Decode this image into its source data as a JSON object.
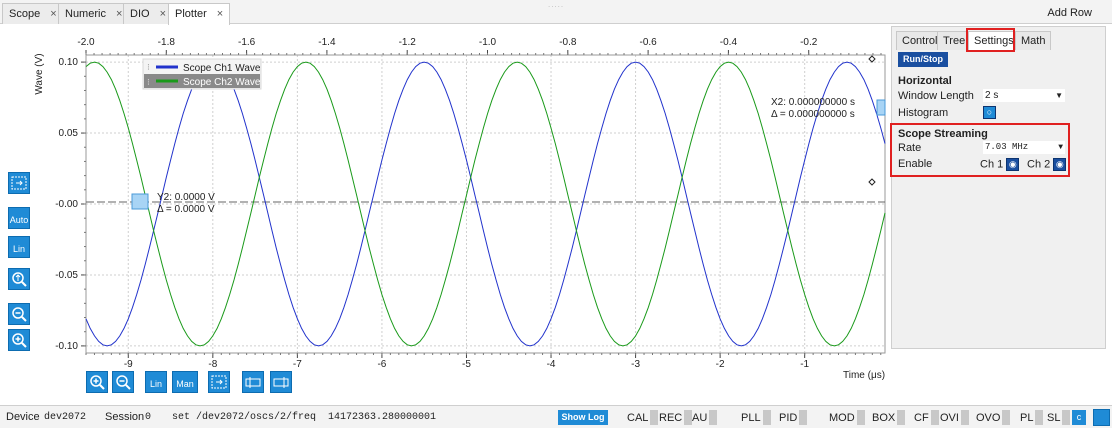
{
  "tabs": [
    {
      "label": "Scope",
      "active": false
    },
    {
      "label": "Numeric",
      "active": false
    },
    {
      "label": "DIO",
      "active": false
    },
    {
      "label": "Plotter",
      "active": true
    }
  ],
  "tab_close": "×",
  "add_row": "Add Row",
  "plot": {
    "y_axis_label": "Wave (V)",
    "x_axis_label": "Time (μs)",
    "top_ticks": [
      "-2.0",
      "-1.8",
      "-1.6",
      "-1.4",
      "-1.2",
      "-1.0",
      "-0.8",
      "-0.6",
      "-0.4",
      "-0.2"
    ],
    "bottom_ticks": [
      "-9",
      "-8",
      "-7",
      "-6",
      "-5",
      "-4",
      "-3",
      "-2",
      "-1"
    ],
    "y_ticks": [
      "0.10",
      "0.05",
      "-0.00",
      "-0.05",
      "-0.10"
    ],
    "legend": [
      {
        "name": "Scope Ch1 Wave",
        "color": "#2233cc"
      },
      {
        "name": "Scope Ch2 Wave",
        "color": "#1a9a1a"
      }
    ],
    "cursor_y": {
      "line1": "Y2: 0.0000 V",
      "line2": "Δ = 0.0000 V"
    },
    "cursor_x": {
      "line1": "X2: 0.000000000 s",
      "line2": "Δ = 0.000000000 s"
    }
  },
  "chart_data": {
    "type": "line",
    "x_range_us": [
      -9.5,
      -0.05
    ],
    "ylim": [
      -0.105,
      0.105
    ],
    "series": [
      {
        "name": "Scope Ch1 Wave",
        "color": "#2233cc",
        "amplitude": 0.1,
        "period_us": 2.5,
        "peak_at_us": -5.5
      },
      {
        "name": "Scope Ch2 Wave",
        "color": "#1a9a1a",
        "amplitude": 0.1,
        "period_us": 2.5,
        "peak_at_us": -6.9
      }
    ],
    "grid": true
  },
  "left_tools": [
    {
      "name": "zoom-fit-icon",
      "label": ""
    },
    {
      "name": "auto-button",
      "label": "Auto"
    },
    {
      "name": "lin-button",
      "label": "Lin"
    },
    {
      "name": "zoom-reset-icon",
      "label": ""
    },
    {
      "name": "zoom-out-icon",
      "label": ""
    },
    {
      "name": "zoom-in-icon",
      "label": ""
    }
  ],
  "bottom_tools": {
    "lin": "Lin",
    "man": "Man"
  },
  "right_panel": {
    "tabs": [
      "Control",
      "Tree",
      "Settings",
      "Math"
    ],
    "active_tab": "Settings",
    "run_stop": "Run/Stop",
    "horizontal_title": "Horizontal",
    "window_length_label": "Window Length",
    "window_length_value": "2 s",
    "histogram_label": "Histogram",
    "streaming_title": "Scope Streaming",
    "rate_label": "Rate",
    "rate_value": "7.03 MHz",
    "enable_label": "Enable",
    "ch1_label": "Ch 1",
    "ch2_label": "Ch 2"
  },
  "status": {
    "device_label": "Device",
    "device_value": "dev2072",
    "session_label": "Session",
    "session_value": "0",
    "command": "set /dev2072/oscs/2/freq  14172363.280000001",
    "show_log": "Show Log",
    "indicators": [
      "CAL",
      "REC",
      "AU",
      "PLL",
      "PID",
      "MOD",
      "BOX",
      "CF",
      "OVI",
      "OVO",
      "PL",
      "SL"
    ],
    "c_icon": "c"
  }
}
